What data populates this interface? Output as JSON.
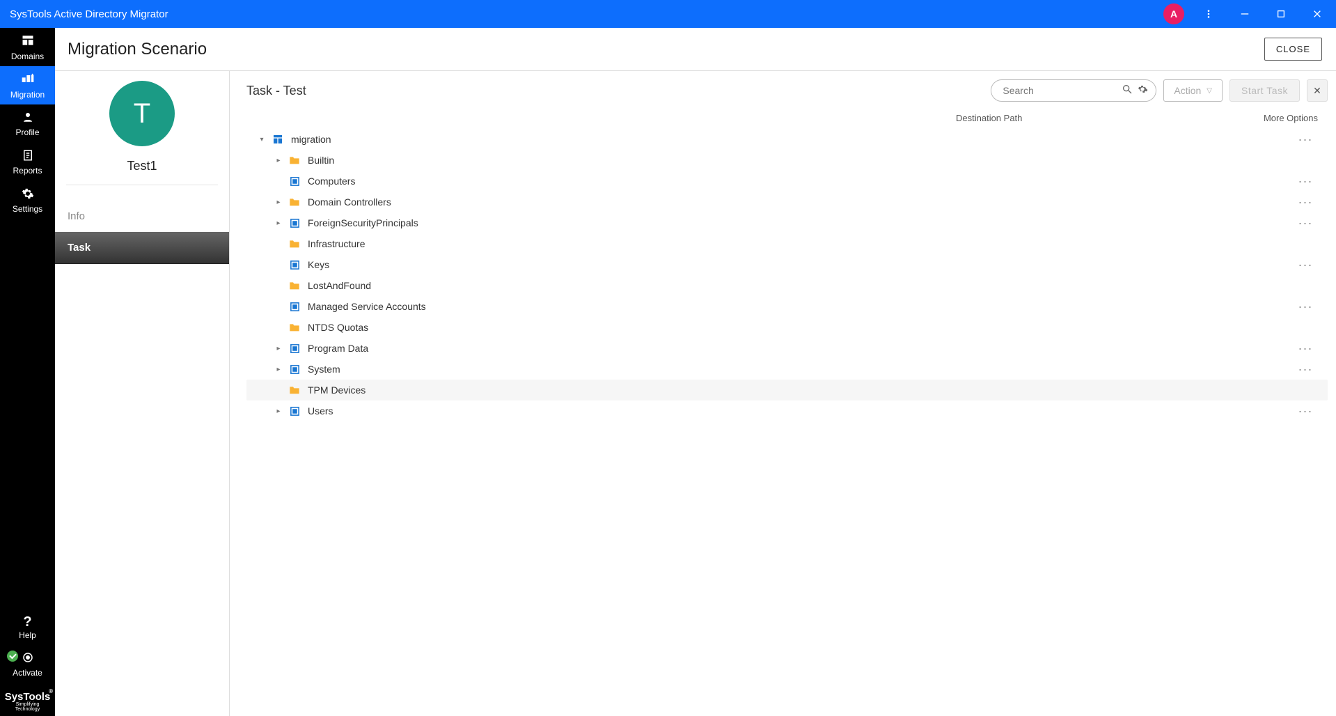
{
  "titlebar": {
    "title": "SysTools Active Directory Migrator",
    "avatar_letter": "A"
  },
  "leftnav": {
    "items": [
      {
        "id": "domains",
        "label": "Domains"
      },
      {
        "id": "migration",
        "label": "Migration"
      },
      {
        "id": "profile",
        "label": "Profile"
      },
      {
        "id": "reports",
        "label": "Reports"
      },
      {
        "id": "settings",
        "label": "Settings"
      }
    ],
    "help_label": "Help",
    "activate_label": "Activate",
    "brand": "SysTools",
    "brand_sub": "Simplifying Technology"
  },
  "header": {
    "title": "Migration Scenario",
    "close": "CLOSE"
  },
  "detail": {
    "avatar_letter": "T",
    "name": "Test1",
    "tab_info": "Info",
    "tab_task": "Task"
  },
  "task": {
    "title": "Task - Test",
    "search_placeholder": "Search",
    "action_label": "Action",
    "start_label": "Start Task",
    "col_dest": "Destination Path",
    "col_more": "More Options"
  },
  "tree": {
    "root": {
      "label": "migration",
      "icon": "domain",
      "arrow": "down",
      "indent": 0,
      "more": true
    },
    "children": [
      {
        "label": "Builtin",
        "icon": "folder",
        "arrow": "right",
        "indent": 1,
        "more": false
      },
      {
        "label": "Computers",
        "icon": "container",
        "arrow": "none",
        "indent": 1,
        "more": true
      },
      {
        "label": "Domain Controllers",
        "icon": "folder",
        "arrow": "right",
        "indent": 1,
        "more": true
      },
      {
        "label": "ForeignSecurityPrincipals",
        "icon": "container",
        "arrow": "right",
        "indent": 1,
        "more": true
      },
      {
        "label": "Infrastructure",
        "icon": "folder",
        "arrow": "none",
        "indent": 1,
        "more": false
      },
      {
        "label": "Keys",
        "icon": "container",
        "arrow": "none",
        "indent": 1,
        "more": true
      },
      {
        "label": "LostAndFound",
        "icon": "folder",
        "arrow": "none",
        "indent": 1,
        "more": false
      },
      {
        "label": "Managed Service Accounts",
        "icon": "container",
        "arrow": "none",
        "indent": 1,
        "more": true
      },
      {
        "label": "NTDS Quotas",
        "icon": "folder",
        "arrow": "none",
        "indent": 1,
        "more": false
      },
      {
        "label": "Program Data",
        "icon": "container",
        "arrow": "right",
        "indent": 1,
        "more": true
      },
      {
        "label": "System",
        "icon": "container",
        "arrow": "right",
        "indent": 1,
        "more": true
      },
      {
        "label": "TPM Devices",
        "icon": "folder",
        "arrow": "none",
        "indent": 1,
        "more": false,
        "hover": true
      },
      {
        "label": "Users",
        "icon": "container",
        "arrow": "right",
        "indent": 1,
        "more": true
      }
    ]
  }
}
